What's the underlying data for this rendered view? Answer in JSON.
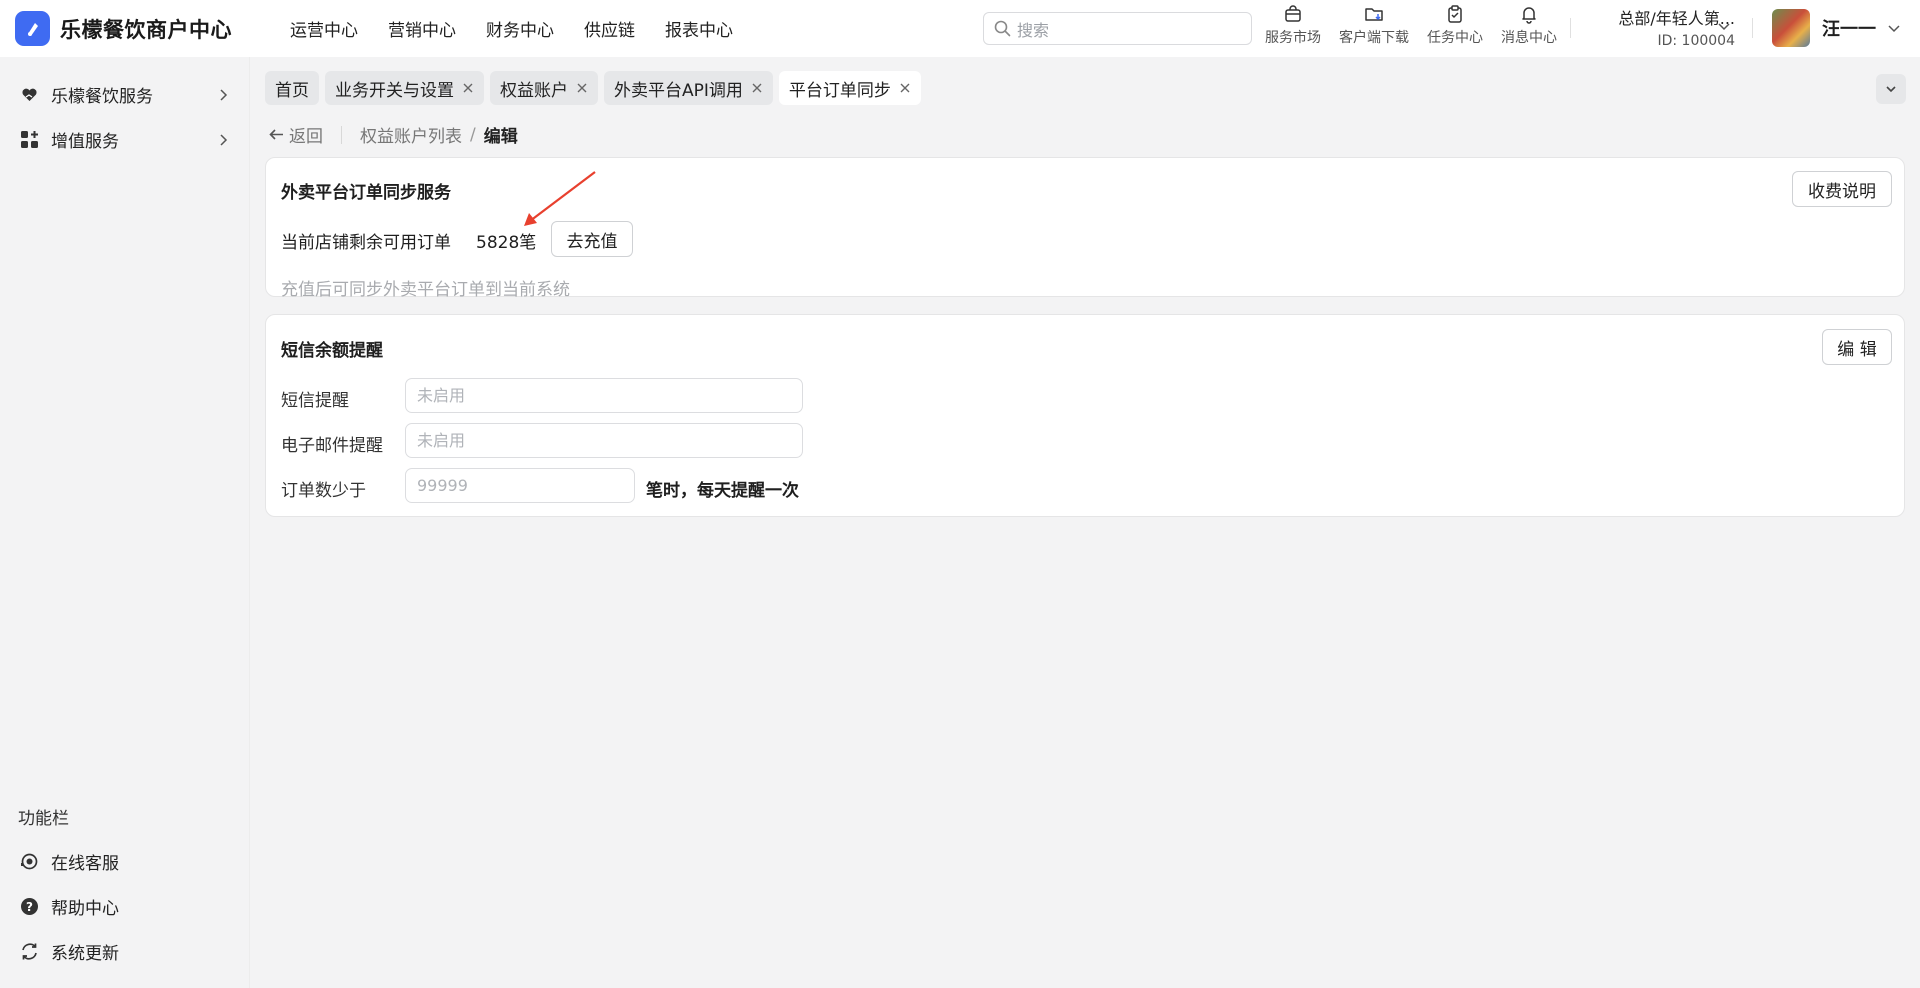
{
  "app": {
    "name": "乐檬餐饮商户中心"
  },
  "topnav": [
    "运营中心",
    "营销中心",
    "财务中心",
    "供应链",
    "报表中心"
  ],
  "search": {
    "placeholder": "搜索"
  },
  "tools": [
    {
      "label": "服务市场",
      "icon": "shopping-bag-icon"
    },
    {
      "label": "客户端下载",
      "icon": "folder-download-icon"
    },
    {
      "label": "任务中心",
      "icon": "clipboard-check-icon"
    },
    {
      "label": "消息中心",
      "icon": "bell-icon"
    }
  ],
  "org": {
    "name": "总部/年轻人第...",
    "id": "ID: 100004"
  },
  "user": {
    "name": "汪一一"
  },
  "sidebar": {
    "items": [
      {
        "label": "乐檬餐饮服务",
        "icon": "heart-hand-icon"
      },
      {
        "label": "增值服务",
        "icon": "apps-icon"
      }
    ],
    "section_title": "功能栏",
    "bottom_items": [
      {
        "label": "在线客服",
        "icon": "headset-icon"
      },
      {
        "label": "帮助中心",
        "icon": "help-circle-icon"
      },
      {
        "label": "系统更新",
        "icon": "refresh-icon"
      }
    ]
  },
  "tabs": [
    {
      "label": "首页",
      "closable": false
    },
    {
      "label": "业务开关与设置",
      "closable": true
    },
    {
      "label": "权益账户",
      "closable": true
    },
    {
      "label": "外卖平台API调用",
      "closable": true
    },
    {
      "label": "平台订单同步",
      "closable": true,
      "active": true
    }
  ],
  "breadcrumb": {
    "back": "返回",
    "parent": "权益账户列表",
    "separator": "/",
    "current": "编辑"
  },
  "order_sync": {
    "title": "外卖平台订单同步服务",
    "fee_button": "收费说明",
    "remaining_label": "当前店铺剩余可用订单",
    "remaining_value": "5828笔",
    "recharge_button": "去充值",
    "hint": "充值后可同步外卖平台订单到当前系统"
  },
  "sms_alert": {
    "title": "短信余额提醒",
    "edit_button": "编 辑",
    "sms_label": "短信提醒",
    "sms_placeholder": "未启用",
    "email_label": "电子邮件提醒",
    "email_placeholder": "未启用",
    "threshold_label": "订单数少于",
    "threshold_placeholder": "99999",
    "threshold_suffix": "笔时，每天提醒一次"
  },
  "colors": {
    "brand": "#3f6bf2",
    "annotation_arrow": "#e8402e"
  }
}
